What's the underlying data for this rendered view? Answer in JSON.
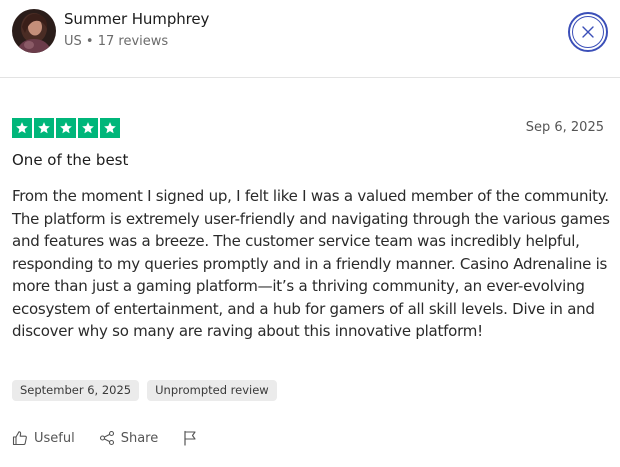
{
  "reviewer": {
    "name": "Summer Humphrey",
    "country": "US",
    "separator": "•",
    "reviews_count": "17 reviews",
    "avatar_icon": "user-avatar"
  },
  "close_icon": "close-icon",
  "review": {
    "rating": 5,
    "max_rating": 5,
    "star_color": "#00b67a",
    "date": "Sep 6, 2025",
    "title": "One of the best",
    "body": "From the moment I signed up, I felt like I was a valued member of the community. The platform is extremely user-friendly and navigating through the various games and features was a breeze. The customer service team was incredibly helpful, responding to my queries promptly and in a friendly manner. Casino Adrenaline is more than just a gaming platform—it’s a thriving community, an ever-evolving ecosystem of entertainment, and a hub for gamers of all skill levels. Dive in and discover why so many are raving about this innovative platform!",
    "tags": [
      "September 6, 2025",
      "Unprompted review"
    ]
  },
  "actions": {
    "useful_label": "Useful",
    "share_label": "Share",
    "useful_icon": "thumbs-up-icon",
    "share_icon": "share-icon",
    "flag_icon": "flag-icon"
  },
  "colors": {
    "accent": "#3b4fb8",
    "trustpilot_green": "#00b67a"
  }
}
